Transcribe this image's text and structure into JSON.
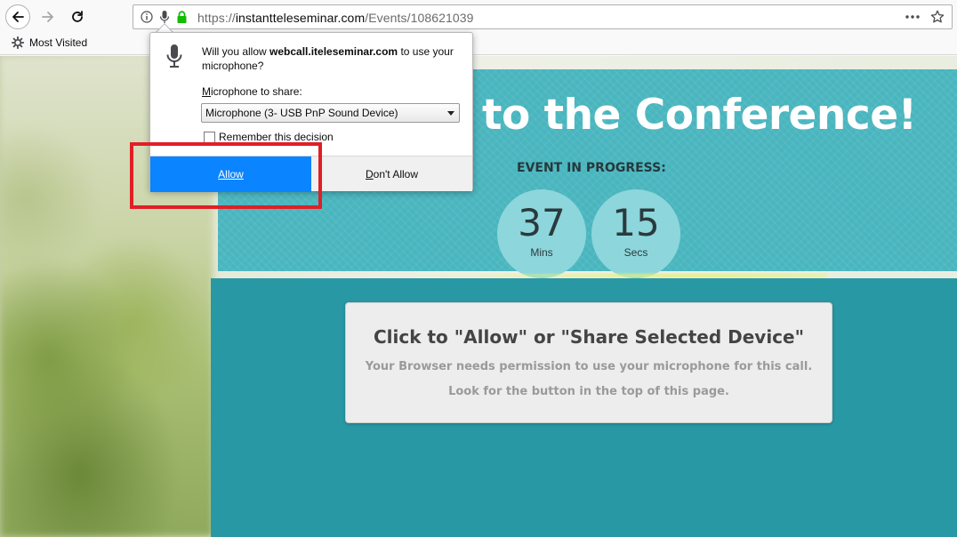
{
  "browser": {
    "url_prefix": "https://",
    "url_host": "instantteleseminar.com",
    "url_path": "/Events/108621039",
    "bookmark_item": "Most Visited"
  },
  "doorhanger": {
    "question_prefix": "Will you allow ",
    "question_host": "webcall.iteleseminar.com",
    "question_suffix": " to use your microphone?",
    "label_underlined": "M",
    "label_rest": "icrophone to share:",
    "selected_device": "Microphone (3- USB PnP Sound Device)",
    "remember_label": "Remember this decision",
    "allow_label": "Allow",
    "deny_underlined": "D",
    "deny_rest": "on't Allow"
  },
  "hero": {
    "title": "to the Conference!",
    "event_label": "EVENT IN PROGRESS:",
    "minutes": "37",
    "minutes_unit": "Mins",
    "seconds": "15",
    "seconds_unit": "Secs"
  },
  "message": {
    "title": "Click to \"Allow\" or \"Share Selected Device\"",
    "line1": "Your Browser needs permission to use your microphone for this call.",
    "line2": "Look for the button in the top of this page."
  },
  "colors": {
    "hero_teal": "#49b5be",
    "band_teal": "#2899a4",
    "allow_blue": "#0a84ff",
    "highlight_red": "#e01f26"
  }
}
